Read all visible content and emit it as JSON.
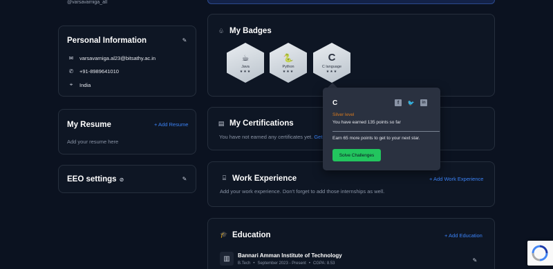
{
  "profile": {
    "username": "@varsavarniga_all"
  },
  "personal_info": {
    "title": "Personal Information",
    "email": "varsavarniga.al23@bitsathy.ac.in",
    "phone": "+91-8989641010",
    "location": "India"
  },
  "resume": {
    "title": "My Resume",
    "add_label": "+ Add Resume",
    "empty_text": "Add your resume here"
  },
  "eeo": {
    "title": "EEO settings"
  },
  "badges": {
    "title": "My Badges",
    "items": [
      {
        "name": "Java",
        "glyph": "☕",
        "stars": "★★★"
      },
      {
        "name": "Python",
        "glyph": "🐍",
        "stars": "★★★"
      },
      {
        "name": "C language",
        "glyph": "C",
        "stars": "★★★"
      }
    ]
  },
  "popover": {
    "title": "C",
    "level": "Silver level",
    "points_text": "You have earned 135 points so far",
    "next_text": "Earn 65 more points to get to your next star.",
    "button_label": "Solve Challenges"
  },
  "certifications": {
    "title": "My Certifications",
    "empty_text": "You have not earned any certificates yet.",
    "link_text": "Get C"
  },
  "work": {
    "title": "Work Experience",
    "add_label": "+ Add Work Experience",
    "empty_text": "Add your work experience. Don't forget to add those internships as well."
  },
  "education": {
    "title": "Education",
    "add_label": "+ Add Education",
    "institution": "Bannari Amman Institute of Technology",
    "degree": "B.Tech",
    "period": "September 2023 - Present",
    "cgpa": "CGPA: 8.53"
  },
  "colors": {
    "accent": "#3b82f6",
    "button": "#22c55e",
    "silver_level": "#d97a1e",
    "background": "#0b1220"
  }
}
